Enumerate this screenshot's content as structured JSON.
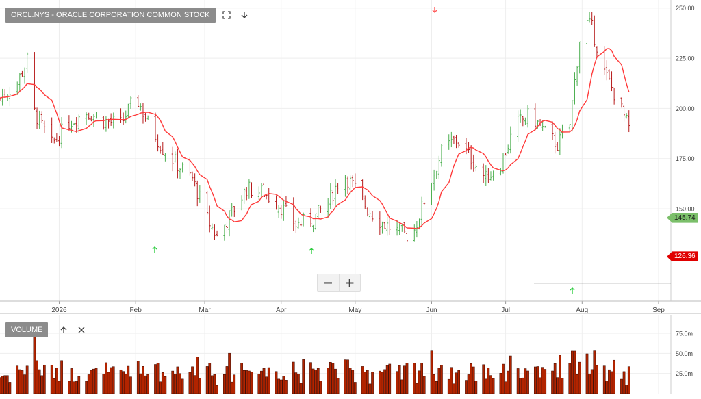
{
  "header": {
    "symbol_title": "ORCL.NYS - ORACLE CORPORATION COMMON STOCK",
    "expand_icon": "expand-icon",
    "down_icon": "arrow-down-icon"
  },
  "volume_panel": {
    "title": "VOLUME",
    "up_icon": "arrow-up-icon",
    "close_icon": "close-icon"
  },
  "zoom": {
    "out_label": "−",
    "in_label": "+"
  },
  "colors": {
    "up": "#4caf50",
    "down": "#b71c1c",
    "ma": "#ff3b3b",
    "volume": "#b22400",
    "grid": "#eeeeee",
    "current_tag": "#7bbf6a",
    "ma_tag": "#e00000"
  },
  "chart_data": {
    "type": "ohlc",
    "x_axis": {
      "ticks": [
        {
          "label": "2026",
          "date": "2026-01-01"
        },
        {
          "label": "Feb",
          "date": "2026-02-01"
        },
        {
          "label": "Mar",
          "date": "2026-03-01"
        },
        {
          "label": "Apr",
          "date": "2026-04-01"
        },
        {
          "label": "May",
          "date": "2026-05-01"
        },
        {
          "label": "Jun",
          "date": "2026-06-01"
        },
        {
          "label": "Jul",
          "date": "2026-07-01"
        },
        {
          "label": "Aug",
          "date": "2026-08-01"
        },
        {
          "label": "Sep",
          "date": "2026-09-01"
        }
      ],
      "range": [
        "2025-12-08",
        "2026-09-06"
      ]
    },
    "price_axis": {
      "ticks": [
        "250.00",
        "225.00",
        "200.00",
        "175.00",
        "150.00"
      ],
      "range": [
        104,
        254
      ]
    },
    "volume_axis": {
      "ticks": [
        "75.0m",
        "50.0m",
        "25.0m"
      ],
      "range": [
        0,
        98
      ]
    },
    "current_price": "145.74",
    "ma_value": "126.36",
    "support_level": 113,
    "series": [
      {
        "name": "price",
        "points": [
          {
            "date": "2025-12-08",
            "v": 205
          },
          {
            "date": "2025-12-15",
            "v": 213
          },
          {
            "date": "2025-12-19",
            "v": 224
          },
          {
            "date": "2025-12-22",
            "v": 198
          },
          {
            "date": "2025-12-29",
            "v": 182
          },
          {
            "date": "2026-01-05",
            "v": 193
          },
          {
            "date": "2026-01-12",
            "v": 198
          },
          {
            "date": "2026-01-19",
            "v": 194
          },
          {
            "date": "2026-01-26",
            "v": 192
          },
          {
            "date": "2026-02-01",
            "v": 206
          },
          {
            "date": "2026-02-06",
            "v": 193
          },
          {
            "date": "2026-02-12",
            "v": 180
          },
          {
            "date": "2026-02-18",
            "v": 172
          },
          {
            "date": "2026-02-24",
            "v": 165
          },
          {
            "date": "2026-03-02",
            "v": 145
          },
          {
            "date": "2026-03-06",
            "v": 136
          },
          {
            "date": "2026-03-12",
            "v": 148
          },
          {
            "date": "2026-03-18",
            "v": 160
          },
          {
            "date": "2026-03-25",
            "v": 158
          },
          {
            "date": "2026-04-01",
            "v": 151
          },
          {
            "date": "2026-04-07",
            "v": 142
          },
          {
            "date": "2026-04-14",
            "v": 145
          },
          {
            "date": "2026-04-20",
            "v": 153
          },
          {
            "date": "2026-04-26",
            "v": 168
          },
          {
            "date": "2026-05-01",
            "v": 160
          },
          {
            "date": "2026-05-06",
            "v": 150
          },
          {
            "date": "2026-05-12",
            "v": 143
          },
          {
            "date": "2026-05-18",
            "v": 139
          },
          {
            "date": "2026-05-24",
            "v": 136
          },
          {
            "date": "2026-05-30",
            "v": 158
          },
          {
            "date": "2026-06-05",
            "v": 178
          },
          {
            "date": "2026-06-11",
            "v": 185
          },
          {
            "date": "2026-06-17",
            "v": 175
          },
          {
            "date": "2026-06-23",
            "v": 165
          },
          {
            "date": "2026-06-29",
            "v": 172
          },
          {
            "date": "2026-07-05",
            "v": 192
          },
          {
            "date": "2026-07-11",
            "v": 197
          },
          {
            "date": "2026-07-17",
            "v": 188
          },
          {
            "date": "2026-07-22",
            "v": 182
          },
          {
            "date": "2026-07-27",
            "v": 192
          },
          {
            "date": "2026-08-01",
            "v": 245
          },
          {
            "date": "2026-08-05",
            "v": 240
          },
          {
            "date": "2026-08-10",
            "v": 218
          },
          {
            "date": "2026-08-15",
            "v": 205
          },
          {
            "date": "2026-08-20",
            "v": 190
          }
        ]
      }
    ]
  }
}
